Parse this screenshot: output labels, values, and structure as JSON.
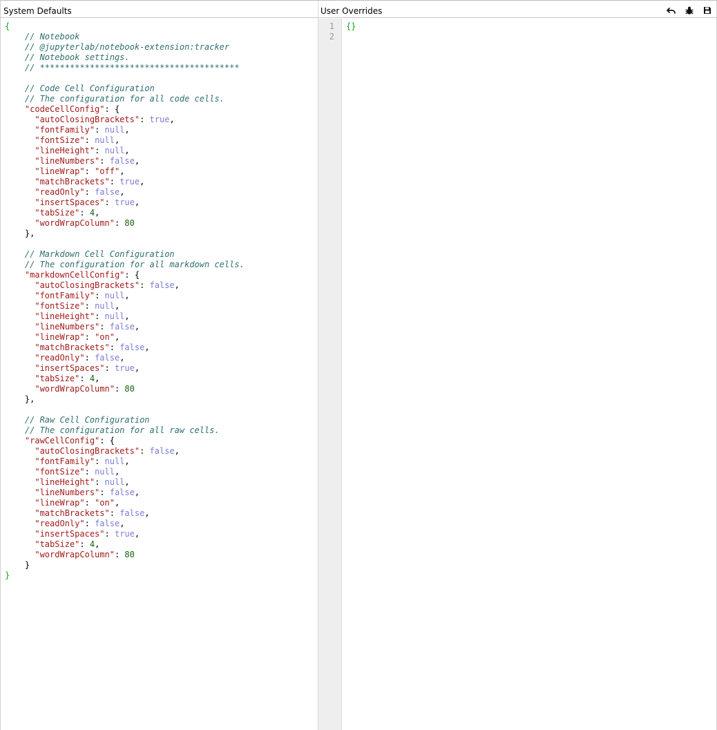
{
  "left_pane": {
    "title": "System Defaults",
    "lines": [
      [
        {
          "t": "{",
          "c": "brace"
        }
      ],
      [
        {
          "t": "    "
        },
        {
          "t": "// Notebook",
          "c": "comment"
        }
      ],
      [
        {
          "t": "    "
        },
        {
          "t": "// @jupyterlab/notebook-extension:tracker",
          "c": "comment"
        }
      ],
      [
        {
          "t": "    "
        },
        {
          "t": "// Notebook settings.",
          "c": "comment"
        }
      ],
      [
        {
          "t": "    "
        },
        {
          "t": "// ****************************************",
          "c": "comment"
        }
      ],
      [
        {
          "t": ""
        }
      ],
      [
        {
          "t": "    "
        },
        {
          "t": "// Code Cell Configuration",
          "c": "comment"
        }
      ],
      [
        {
          "t": "    "
        },
        {
          "t": "// The configuration for all code cells.",
          "c": "comment"
        }
      ],
      [
        {
          "t": "    "
        },
        {
          "t": "\"codeCellConfig\"",
          "c": "key"
        },
        {
          "t": ": {",
          "c": "punct"
        }
      ],
      [
        {
          "t": "      "
        },
        {
          "t": "\"autoClosingBrackets\"",
          "c": "key"
        },
        {
          "t": ": ",
          "c": "punct"
        },
        {
          "t": "true",
          "c": "atom"
        },
        {
          "t": ",",
          "c": "punct"
        }
      ],
      [
        {
          "t": "      "
        },
        {
          "t": "\"fontFamily\"",
          "c": "key"
        },
        {
          "t": ": ",
          "c": "punct"
        },
        {
          "t": "null",
          "c": "atom"
        },
        {
          "t": ",",
          "c": "punct"
        }
      ],
      [
        {
          "t": "      "
        },
        {
          "t": "\"fontSize\"",
          "c": "key"
        },
        {
          "t": ": ",
          "c": "punct"
        },
        {
          "t": "null",
          "c": "atom"
        },
        {
          "t": ",",
          "c": "punct"
        }
      ],
      [
        {
          "t": "      "
        },
        {
          "t": "\"lineHeight\"",
          "c": "key"
        },
        {
          "t": ": ",
          "c": "punct"
        },
        {
          "t": "null",
          "c": "atom"
        },
        {
          "t": ",",
          "c": "punct"
        }
      ],
      [
        {
          "t": "      "
        },
        {
          "t": "\"lineNumbers\"",
          "c": "key"
        },
        {
          "t": ": ",
          "c": "punct"
        },
        {
          "t": "false",
          "c": "atom"
        },
        {
          "t": ",",
          "c": "punct"
        }
      ],
      [
        {
          "t": "      "
        },
        {
          "t": "\"lineWrap\"",
          "c": "key"
        },
        {
          "t": ": ",
          "c": "punct"
        },
        {
          "t": "\"off\"",
          "c": "string"
        },
        {
          "t": ",",
          "c": "punct"
        }
      ],
      [
        {
          "t": "      "
        },
        {
          "t": "\"matchBrackets\"",
          "c": "key"
        },
        {
          "t": ": ",
          "c": "punct"
        },
        {
          "t": "true",
          "c": "atom"
        },
        {
          "t": ",",
          "c": "punct"
        }
      ],
      [
        {
          "t": "      "
        },
        {
          "t": "\"readOnly\"",
          "c": "key"
        },
        {
          "t": ": ",
          "c": "punct"
        },
        {
          "t": "false",
          "c": "atom"
        },
        {
          "t": ",",
          "c": "punct"
        }
      ],
      [
        {
          "t": "      "
        },
        {
          "t": "\"insertSpaces\"",
          "c": "key"
        },
        {
          "t": ": ",
          "c": "punct"
        },
        {
          "t": "true",
          "c": "atom"
        },
        {
          "t": ",",
          "c": "punct"
        }
      ],
      [
        {
          "t": "      "
        },
        {
          "t": "\"tabSize\"",
          "c": "key"
        },
        {
          "t": ": ",
          "c": "punct"
        },
        {
          "t": "4",
          "c": "number"
        },
        {
          "t": ",",
          "c": "punct"
        }
      ],
      [
        {
          "t": "      "
        },
        {
          "t": "\"wordWrapColumn\"",
          "c": "key"
        },
        {
          "t": ": ",
          "c": "punct"
        },
        {
          "t": "80",
          "c": "number"
        }
      ],
      [
        {
          "t": "    "
        },
        {
          "t": "},",
          "c": "punct"
        }
      ],
      [
        {
          "t": ""
        }
      ],
      [
        {
          "t": "    "
        },
        {
          "t": "// Markdown Cell Configuration",
          "c": "comment"
        }
      ],
      [
        {
          "t": "    "
        },
        {
          "t": "// The configuration for all markdown cells.",
          "c": "comment"
        }
      ],
      [
        {
          "t": "    "
        },
        {
          "t": "\"markdownCellConfig\"",
          "c": "key"
        },
        {
          "t": ": {",
          "c": "punct"
        }
      ],
      [
        {
          "t": "      "
        },
        {
          "t": "\"autoClosingBrackets\"",
          "c": "key"
        },
        {
          "t": ": ",
          "c": "punct"
        },
        {
          "t": "false",
          "c": "atom"
        },
        {
          "t": ",",
          "c": "punct"
        }
      ],
      [
        {
          "t": "      "
        },
        {
          "t": "\"fontFamily\"",
          "c": "key"
        },
        {
          "t": ": ",
          "c": "punct"
        },
        {
          "t": "null",
          "c": "atom"
        },
        {
          "t": ",",
          "c": "punct"
        }
      ],
      [
        {
          "t": "      "
        },
        {
          "t": "\"fontSize\"",
          "c": "key"
        },
        {
          "t": ": ",
          "c": "punct"
        },
        {
          "t": "null",
          "c": "atom"
        },
        {
          "t": ",",
          "c": "punct"
        }
      ],
      [
        {
          "t": "      "
        },
        {
          "t": "\"lineHeight\"",
          "c": "key"
        },
        {
          "t": ": ",
          "c": "punct"
        },
        {
          "t": "null",
          "c": "atom"
        },
        {
          "t": ",",
          "c": "punct"
        }
      ],
      [
        {
          "t": "      "
        },
        {
          "t": "\"lineNumbers\"",
          "c": "key"
        },
        {
          "t": ": ",
          "c": "punct"
        },
        {
          "t": "false",
          "c": "atom"
        },
        {
          "t": ",",
          "c": "punct"
        }
      ],
      [
        {
          "t": "      "
        },
        {
          "t": "\"lineWrap\"",
          "c": "key"
        },
        {
          "t": ": ",
          "c": "punct"
        },
        {
          "t": "\"on\"",
          "c": "string"
        },
        {
          "t": ",",
          "c": "punct"
        }
      ],
      [
        {
          "t": "      "
        },
        {
          "t": "\"matchBrackets\"",
          "c": "key"
        },
        {
          "t": ": ",
          "c": "punct"
        },
        {
          "t": "false",
          "c": "atom"
        },
        {
          "t": ",",
          "c": "punct"
        }
      ],
      [
        {
          "t": "      "
        },
        {
          "t": "\"readOnly\"",
          "c": "key"
        },
        {
          "t": ": ",
          "c": "punct"
        },
        {
          "t": "false",
          "c": "atom"
        },
        {
          "t": ",",
          "c": "punct"
        }
      ],
      [
        {
          "t": "      "
        },
        {
          "t": "\"insertSpaces\"",
          "c": "key"
        },
        {
          "t": ": ",
          "c": "punct"
        },
        {
          "t": "true",
          "c": "atom"
        },
        {
          "t": ",",
          "c": "punct"
        }
      ],
      [
        {
          "t": "      "
        },
        {
          "t": "\"tabSize\"",
          "c": "key"
        },
        {
          "t": ": ",
          "c": "punct"
        },
        {
          "t": "4",
          "c": "number"
        },
        {
          "t": ",",
          "c": "punct"
        }
      ],
      [
        {
          "t": "      "
        },
        {
          "t": "\"wordWrapColumn\"",
          "c": "key"
        },
        {
          "t": ": ",
          "c": "punct"
        },
        {
          "t": "80",
          "c": "number"
        }
      ],
      [
        {
          "t": "    "
        },
        {
          "t": "},",
          "c": "punct"
        }
      ],
      [
        {
          "t": ""
        }
      ],
      [
        {
          "t": "    "
        },
        {
          "t": "// Raw Cell Configuration",
          "c": "comment"
        }
      ],
      [
        {
          "t": "    "
        },
        {
          "t": "// The configuration for all raw cells.",
          "c": "comment"
        }
      ],
      [
        {
          "t": "    "
        },
        {
          "t": "\"rawCellConfig\"",
          "c": "key"
        },
        {
          "t": ": {",
          "c": "punct"
        }
      ],
      [
        {
          "t": "      "
        },
        {
          "t": "\"autoClosingBrackets\"",
          "c": "key"
        },
        {
          "t": ": ",
          "c": "punct"
        },
        {
          "t": "false",
          "c": "atom"
        },
        {
          "t": ",",
          "c": "punct"
        }
      ],
      [
        {
          "t": "      "
        },
        {
          "t": "\"fontFamily\"",
          "c": "key"
        },
        {
          "t": ": ",
          "c": "punct"
        },
        {
          "t": "null",
          "c": "atom"
        },
        {
          "t": ",",
          "c": "punct"
        }
      ],
      [
        {
          "t": "      "
        },
        {
          "t": "\"fontSize\"",
          "c": "key"
        },
        {
          "t": ": ",
          "c": "punct"
        },
        {
          "t": "null",
          "c": "atom"
        },
        {
          "t": ",",
          "c": "punct"
        }
      ],
      [
        {
          "t": "      "
        },
        {
          "t": "\"lineHeight\"",
          "c": "key"
        },
        {
          "t": ": ",
          "c": "punct"
        },
        {
          "t": "null",
          "c": "atom"
        },
        {
          "t": ",",
          "c": "punct"
        }
      ],
      [
        {
          "t": "      "
        },
        {
          "t": "\"lineNumbers\"",
          "c": "key"
        },
        {
          "t": ": ",
          "c": "punct"
        },
        {
          "t": "false",
          "c": "atom"
        },
        {
          "t": ",",
          "c": "punct"
        }
      ],
      [
        {
          "t": "      "
        },
        {
          "t": "\"lineWrap\"",
          "c": "key"
        },
        {
          "t": ": ",
          "c": "punct"
        },
        {
          "t": "\"on\"",
          "c": "string"
        },
        {
          "t": ",",
          "c": "punct"
        }
      ],
      [
        {
          "t": "      "
        },
        {
          "t": "\"matchBrackets\"",
          "c": "key"
        },
        {
          "t": ": ",
          "c": "punct"
        },
        {
          "t": "false",
          "c": "atom"
        },
        {
          "t": ",",
          "c": "punct"
        }
      ],
      [
        {
          "t": "      "
        },
        {
          "t": "\"readOnly\"",
          "c": "key"
        },
        {
          "t": ": ",
          "c": "punct"
        },
        {
          "t": "false",
          "c": "atom"
        },
        {
          "t": ",",
          "c": "punct"
        }
      ],
      [
        {
          "t": "      "
        },
        {
          "t": "\"insertSpaces\"",
          "c": "key"
        },
        {
          "t": ": ",
          "c": "punct"
        },
        {
          "t": "true",
          "c": "atom"
        },
        {
          "t": ",",
          "c": "punct"
        }
      ],
      [
        {
          "t": "      "
        },
        {
          "t": "\"tabSize\"",
          "c": "key"
        },
        {
          "t": ": ",
          "c": "punct"
        },
        {
          "t": "4",
          "c": "number"
        },
        {
          "t": ",",
          "c": "punct"
        }
      ],
      [
        {
          "t": "      "
        },
        {
          "t": "\"wordWrapColumn\"",
          "c": "key"
        },
        {
          "t": ": ",
          "c": "punct"
        },
        {
          "t": "80",
          "c": "number"
        }
      ],
      [
        {
          "t": "    "
        },
        {
          "t": "}",
          "c": "punct"
        }
      ],
      [
        {
          "t": "}",
          "c": "brace"
        }
      ]
    ]
  },
  "right_pane": {
    "title": "User Overrides",
    "toolbar": [
      {
        "name": "revert-button",
        "icon": "undo-icon"
      },
      {
        "name": "debug-button",
        "icon": "bug-icon"
      },
      {
        "name": "save-button",
        "icon": "save-icon"
      }
    ],
    "line_numbers": [
      "1",
      "2"
    ],
    "lines": [
      [
        {
          "t": "{}",
          "c": "brace"
        }
      ],
      [
        {
          "t": ""
        }
      ]
    ]
  },
  "colors": {
    "brace": "#11a311",
    "comment": "#2f6f6f",
    "key": "#a31a1a",
    "atom": "#7b7bd8",
    "number": "#116611",
    "gutter_bg": "#eeeeee"
  }
}
